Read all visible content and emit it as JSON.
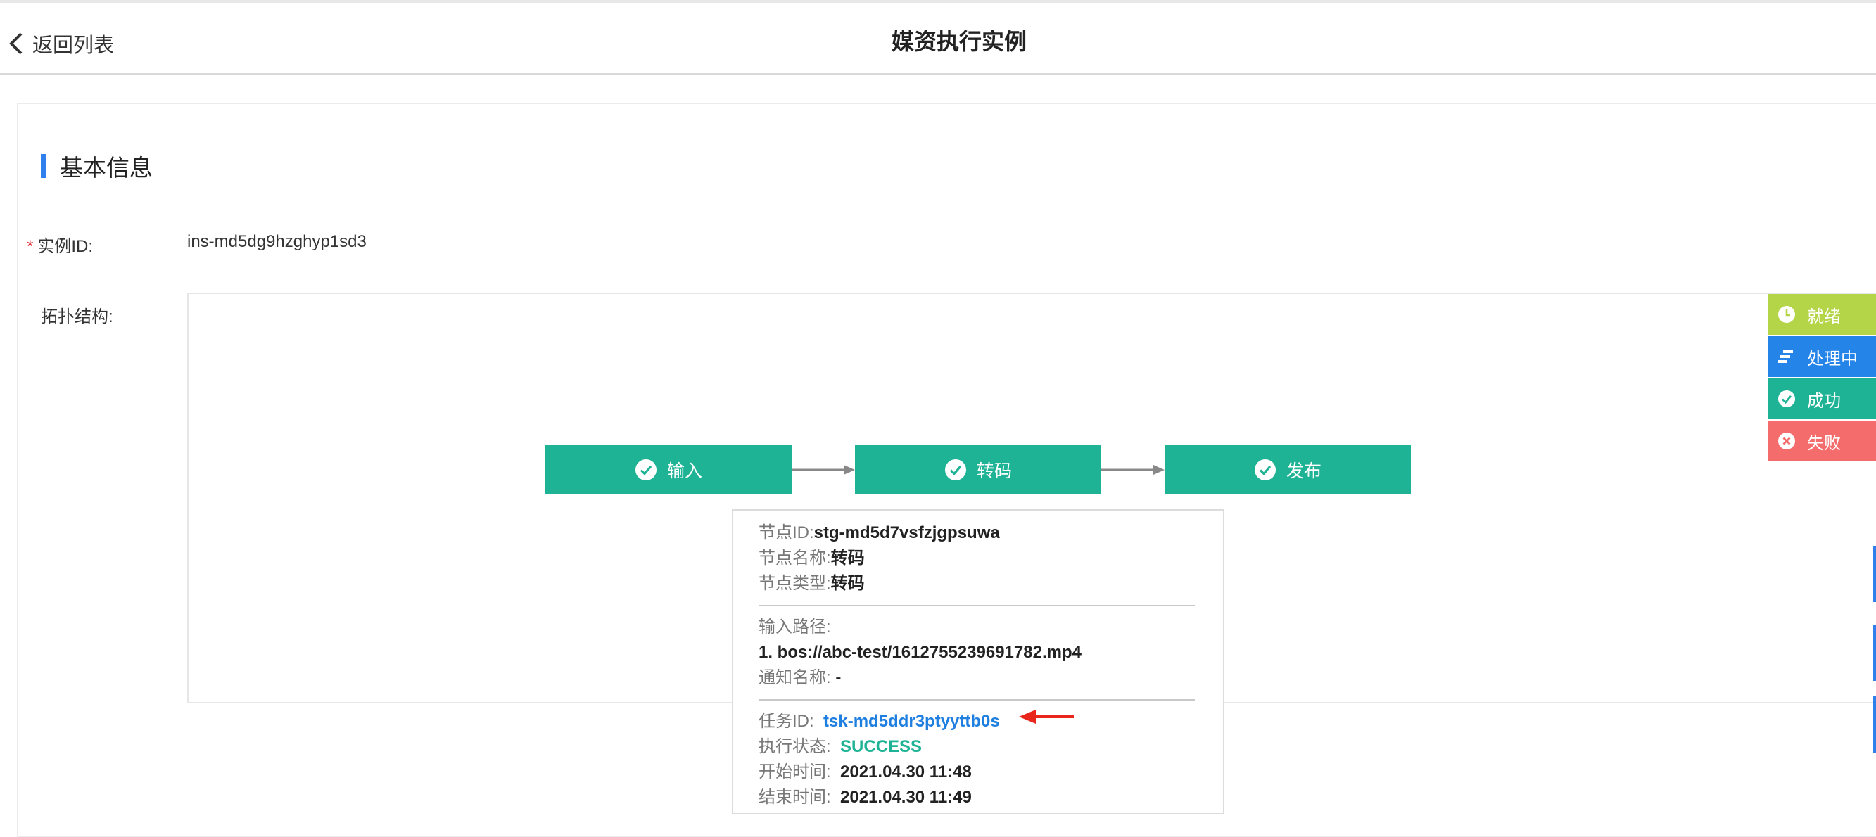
{
  "header": {
    "back_label": "返回列表",
    "title": "媒资执行实例"
  },
  "section": {
    "title": "基本信息"
  },
  "fields": {
    "instance_id_label": "实例ID:",
    "instance_id_value": "ins-md5dg9hzghyp1sd3",
    "topology_label": "拓扑结构:"
  },
  "nodes": [
    {
      "label": "输入"
    },
    {
      "label": "转码"
    },
    {
      "label": "发布"
    }
  ],
  "legend": [
    {
      "label": "就绪",
      "color": "#b5d548",
      "icon": "clock-icon"
    },
    {
      "label": "处理中",
      "color": "#2584e8",
      "icon": "processing-icon"
    },
    {
      "label": "成功",
      "color": "#1fb395",
      "icon": "check-circle-icon"
    },
    {
      "label": "失败",
      "color": "#f56c6c",
      "icon": "close-circle-icon"
    }
  ],
  "tooltip": {
    "node_id_k": "节点ID:",
    "node_id_v": "stg-md5d7vsfzjgpsuwa",
    "node_name_k": "节点名称:",
    "node_name_v": "转码",
    "node_type_k": "节点类型:",
    "node_type_v": "转码",
    "input_path_k": "输入路径:",
    "input_path_v": "1. bos://abc-test/1612755239691782.mp4",
    "notify_k": "通知名称:",
    "notify_v": "-",
    "task_id_k": "任务ID:",
    "task_id_v": "tsk-md5ddr3ptyyttb0s",
    "status_k": "执行状态:",
    "status_v": "SUCCESS",
    "start_k": "开始时间:",
    "start_v": "2021.04.30 11:48",
    "end_k": "结束时间:",
    "end_v": "2021.04.30 11:49"
  }
}
